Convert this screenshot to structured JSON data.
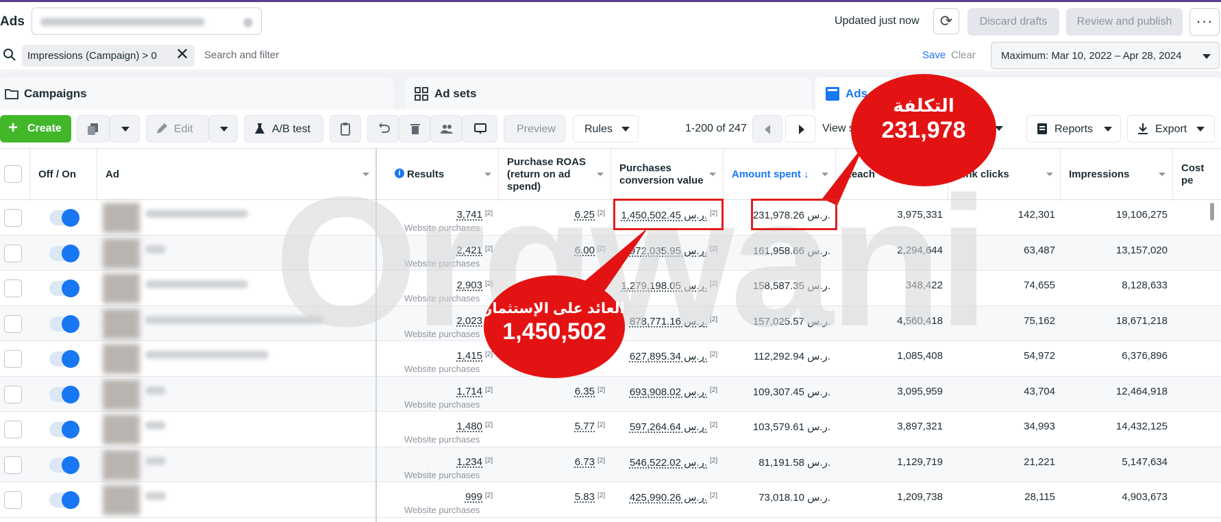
{
  "header": {
    "app_title": "Ads",
    "updated": "Updated just now",
    "discard": "Discard drafts",
    "review": "Review and publish",
    "more": "···"
  },
  "filter": {
    "chip": "Impressions (Campaign) > 0",
    "chip_close": "✕",
    "placeholder": "Search and filter",
    "save": "Save",
    "clear": "Clear",
    "date_range": "Maximum: Mar 10, 2022 – Apr 28, 2024"
  },
  "tabs": {
    "campaigns": "Campaigns",
    "ad_sets": "Ad sets",
    "ads": "Ads"
  },
  "toolbar": {
    "create": "Create",
    "edit": "Edit",
    "ab_test": "A/B test",
    "preview": "Preview",
    "rules": "Rules",
    "pagination": "1-200 of 247",
    "view": "View s",
    "reports": "Reports",
    "export": "Export"
  },
  "columns": {
    "off_on": "Off / On",
    "ad": "Ad",
    "results": "Results",
    "roas": "Purchase ROAS (return on ad spend)",
    "conv_value": "Purchases conversion value",
    "amount_spent": "Amount spent ↓",
    "reach": "Reach",
    "link_clicks": "Link clicks",
    "impressions": "Impressions",
    "cost_per": "Cost pe"
  },
  "result_type": "Website purchases",
  "footnote": "[2]",
  "rows": [
    {
      "results": "3,741",
      "roas": "6.25",
      "conv": "1,450,502.45 ر.س.",
      "spent": "231,978.26 ر.س.",
      "reach": "3,975,331",
      "clicks": "142,301",
      "impressions": "19,106,275"
    },
    {
      "results": "2,421",
      "roas": "6.00",
      "conv": "972,035.95 ر.س.",
      "spent": "161,958.66 ر.س.",
      "reach": "2,294,644",
      "clicks": "63,487",
      "impressions": "13,157,020"
    },
    {
      "results": "2,903",
      "roas": "",
      "conv": "1,279,198.05 ر.س.",
      "spent": "158,587.35 ر.س.",
      "reach": "348,422",
      "clicks": "74,655",
      "impressions": "8,128,633"
    },
    {
      "results": "2,023",
      "roas": "",
      "conv": "878,771.16 ر.س.",
      "spent": "157,025.57 ر.س.",
      "reach": "4,560,418",
      "clicks": "75,162",
      "impressions": "18,671,218"
    },
    {
      "results": "1,415",
      "roas": "",
      "conv": "627,895.34 ر.س.",
      "spent": "112,292.94 ر.س.",
      "reach": "1,085,408",
      "clicks": "54,972",
      "impressions": "6,376,896"
    },
    {
      "results": "1,714",
      "roas": "6.35",
      "conv": "693,908.02 ر.س.",
      "spent": "109,307.45 ر.س.",
      "reach": "3,095,959",
      "clicks": "43,704",
      "impressions": "12,464,918"
    },
    {
      "results": "1,480",
      "roas": "5.77",
      "conv": "597,264.64 ر.س.",
      "spent": "103,579.61 ر.س.",
      "reach": "3,897,321",
      "clicks": "34,993",
      "impressions": "14,432,125"
    },
    {
      "results": "1,234",
      "roas": "6.73",
      "conv": "546,522.02 ر.س.",
      "spent": "81,191.58 ر.س.",
      "reach": "1,129,719",
      "clicks": "21,221",
      "impressions": "5,147,634"
    },
    {
      "results": "999",
      "roas": "5.83",
      "conv": "425,990.26 ر.س.",
      "spent": "73,018.10 ر.س.",
      "reach": "1,209,738",
      "clicks": "28,115",
      "impressions": "4,903,673"
    }
  ],
  "watermark": "Orgwani",
  "annotations": {
    "cost_label": "التكلفة",
    "cost_value": "231,978",
    "roi_label": "العائد على الإستثمار",
    "roi_value": "1,450,502"
  },
  "colors": {
    "accent": "#1877f2",
    "create": "#42b72a",
    "annotation": "#e31313"
  }
}
